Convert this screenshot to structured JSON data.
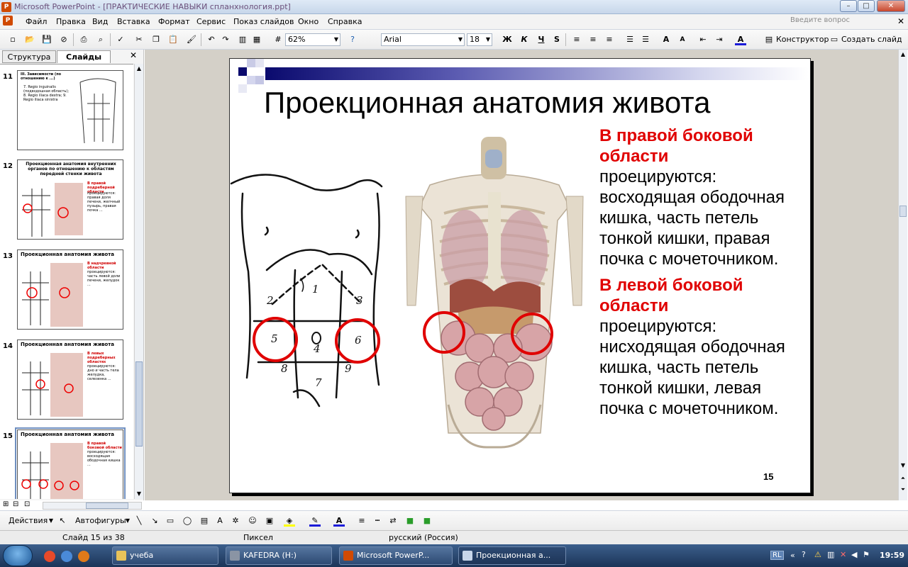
{
  "window": {
    "title": "Microsoft PowerPoint - [ПРАКТИЧЕСКИЕ НАВЫКИ спланхнология.ppt]",
    "app_icon": "P"
  },
  "menu": {
    "items": [
      "Файл",
      "Правка",
      "Вид",
      "Вставка",
      "Формат",
      "Сервис",
      "Показ слайдов",
      "Окно",
      "Справка"
    ],
    "ask_placeholder": "Введите вопрос"
  },
  "toolbar": {
    "zoom": "62%",
    "font": "Arial",
    "size": "18",
    "bold": "Ж",
    "italic": "К",
    "underline": "Ч",
    "shadow": "S",
    "design": "Конструктор",
    "new_slide": "Создать слайд"
  },
  "panel": {
    "tabs": [
      "Структура",
      "Слайды"
    ],
    "thumbs": [
      {
        "num": "11",
        "title": "III. Зависимости (по отношению к ...)",
        "text": "7. Regio inguinalis (подвздошная область); 8. Regio iliaca dextra; 9. Regio iliaca sinistra"
      },
      {
        "num": "12",
        "title": "Проекционная анатомия внутренних органов по отношению к областям передней стенки живота",
        "red": "В правой подреберной области",
        "text": "проецируются: правая доля печени, желчный пузырь, правая почка ..."
      },
      {
        "num": "13",
        "title": "Проекционная анатомия живота",
        "red": "В надчревной области",
        "text": "проецируются: часть левой доли печени, желудок ..."
      },
      {
        "num": "14",
        "title": "Проекционная анатомия живота",
        "red": "В левых подреберных областях",
        "text": "проецируются: дно и часть тела желудка, селезенка ..."
      },
      {
        "num": "15",
        "title": "Проекционная анатомия живота",
        "red": "В правой боковой области",
        "text": "проецируются: восходящая ободочная кишка ..."
      }
    ]
  },
  "slide": {
    "title": "Проекционная анатомия живота",
    "right_heading": "В правой боковой области",
    "right_text": "проецируются: восходящая ободочная кишка, часть петель тонкой кишки, правая почка с мочеточником.",
    "left_heading": "В левой боковой области",
    "left_text": "проецируются: нисходящая ободочная кишка, часть петель тонкой кишки, левая почка с мочеточником.",
    "page_number": "15",
    "regions": [
      "1",
      "2",
      "3",
      "4",
      "5",
      "6",
      "7",
      "8",
      "9"
    ]
  },
  "drawbar": {
    "actions": "Действия",
    "autoshapes": "Автофигуры"
  },
  "status": {
    "slide": "Слайд 15 из 38",
    "design": "Пиксел",
    "lang": "русский (Россия)"
  },
  "taskbar": {
    "items": [
      "учеба",
      "KAFEDRA (H:)",
      "Microsoft PowerP...",
      "Проекционная а..."
    ],
    "lang": "RL",
    "time": "19:59"
  }
}
